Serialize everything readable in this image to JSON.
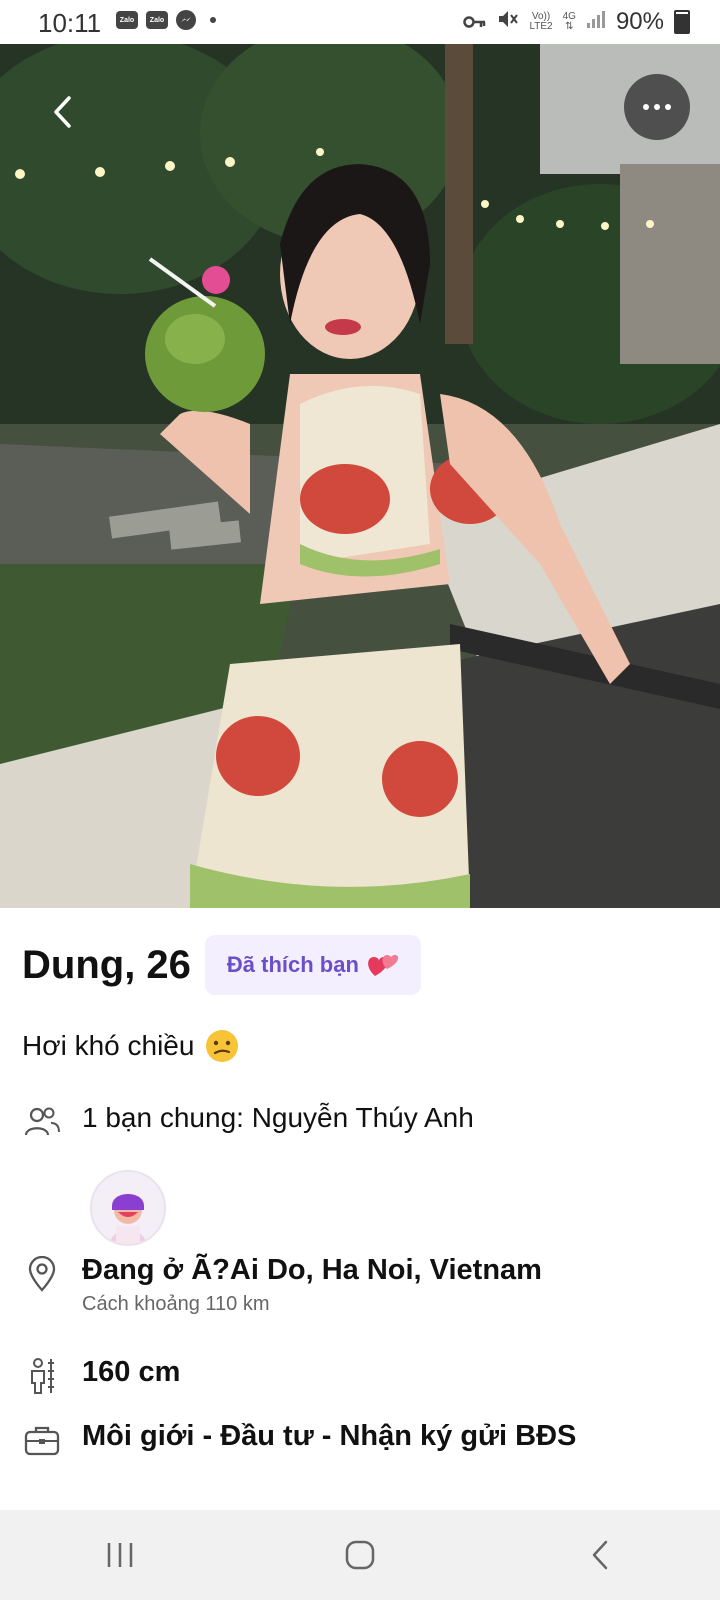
{
  "status_bar": {
    "time": "10:11",
    "notification_apps": [
      "Zalo",
      "Zalo"
    ],
    "network_top": "Vo))",
    "network_bottom": "LTE2",
    "data_type": "4G",
    "battery_percent": "90%"
  },
  "photo": {
    "icons": {
      "back": "chevron-left-icon",
      "more": "more-horizontal-icon"
    }
  },
  "profile": {
    "name_age": "Dung, 26",
    "liked_badge": "Đã thích bạn",
    "bio": "Hơi khó chiều",
    "mutual_friends": "1 bạn chung: Nguyễn Thúy Anh",
    "location": "Đang ở Ã?Ai Do, Ha Noi, Vietnam",
    "distance": "Cách  khoảng 110 km",
    "height": "160 cm",
    "job": "Môi giới - Đầu tư - Nhận ký gửi BĐS"
  },
  "colors": {
    "badge_bg": "#f3efff",
    "badge_text": "#6b4fc9",
    "heart": "#e53a5c",
    "nav_bg": "#f1f1f1"
  }
}
